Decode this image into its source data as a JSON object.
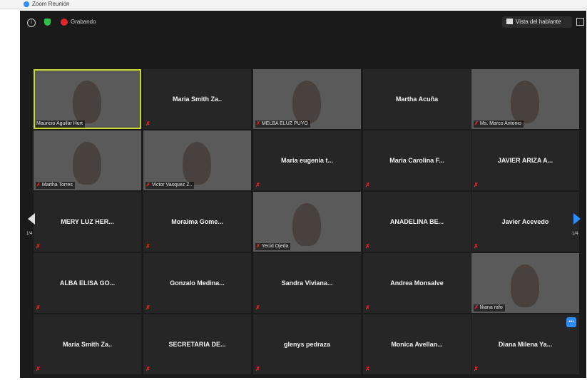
{
  "titlebar": {
    "title": "Zoom Reunión"
  },
  "topbar": {
    "recording_label": "Grabando",
    "speaker_view_label": "Vista del hablante"
  },
  "navigation": {
    "left_page": "1/4",
    "right_page": "1/4"
  },
  "participants": [
    {
      "name": "Mauricio Aguilar Hurt",
      "video": true,
      "active": true,
      "muted": false
    },
    {
      "name": "Maria Smith Za..",
      "video": false,
      "muted": true
    },
    {
      "name": "MELBA ELUZ PUYO",
      "video": true,
      "muted": true
    },
    {
      "name": "Martha Acuña",
      "video": false,
      "muted": false
    },
    {
      "name": "Ms. Marco Antonio",
      "video": true,
      "muted": true
    },
    {
      "name": "Martha Torres",
      "video": true,
      "muted": true
    },
    {
      "name": "Victor Vasquez Z..",
      "video": true,
      "muted": true
    },
    {
      "name": "Maria eugenia t...",
      "video": false,
      "muted": true
    },
    {
      "name": "Maria Carolina F...",
      "video": false,
      "muted": true
    },
    {
      "name": "JAVIER ARIZA A...",
      "video": false,
      "muted": true
    },
    {
      "name": "MERY LUZ HER...",
      "video": false,
      "muted": true
    },
    {
      "name": "Moraima Gome...",
      "video": false,
      "muted": true
    },
    {
      "name": "Yecid Ojeda",
      "video": true,
      "muted": true
    },
    {
      "name": "ANADELINA BE...",
      "video": false,
      "muted": true
    },
    {
      "name": "Javier Acevedo",
      "video": false,
      "muted": true
    },
    {
      "name": "ALBA ELISA GO...",
      "video": false,
      "muted": true
    },
    {
      "name": "Gonzalo Medina...",
      "video": false,
      "muted": true
    },
    {
      "name": "Sandra Viviana...",
      "video": false,
      "muted": true
    },
    {
      "name": "Andrea Monsalve",
      "video": false,
      "muted": true
    },
    {
      "name": "liliana rafo",
      "video": true,
      "muted": true
    },
    {
      "name": "Maria Smith Za..",
      "video": false,
      "muted": true
    },
    {
      "name": "SECRETARIA DE...",
      "video": false,
      "muted": true
    },
    {
      "name": "glenys pedraza",
      "video": false,
      "muted": true
    },
    {
      "name": "Monica Avellan...",
      "video": false,
      "muted": true
    },
    {
      "name": "Diana Milena Ya...",
      "video": false,
      "muted": true
    }
  ],
  "icons": {
    "info": "info-icon",
    "security": "shield-icon",
    "recording": "record-icon",
    "fullscreen": "fullscreen-icon",
    "muted": "muted-mic-icon",
    "prev": "arrow-left-icon",
    "next": "arrow-right-icon",
    "chat": "chat-icon"
  },
  "colors": {
    "active_speaker": "#c6d92e",
    "muted": "#e02828",
    "accent": "#2d8cff",
    "background": "#1a1a1a",
    "tile": "#262626"
  }
}
